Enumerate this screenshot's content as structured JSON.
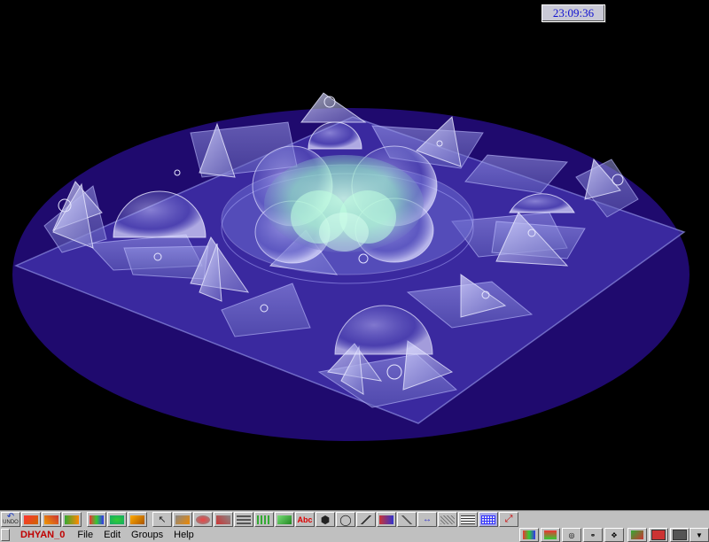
{
  "clock": {
    "time": "23:09:36"
  },
  "toolbar": {
    "undo_label": "UNDO",
    "text_tool_label": "Abc",
    "icons": [
      "undo-icon",
      "red-curves-icon",
      "orange-curve-icon",
      "green-arrow-icon",
      "colorful-shapes-icon",
      "green-spiral-icon",
      "orange-tool-icon",
      "pointer-icon",
      "pencil-icon",
      "rotate-icon",
      "scale-icon",
      "layers-icon",
      "grid-pattern-icon",
      "green-cube-icon",
      "text-tool-icon",
      "octagon-icon",
      "circle-icon",
      "line-tool-icon",
      "wave-icon",
      "diagonal-line-icon",
      "arrows-icon",
      "mesh-icon",
      "table-icon",
      "grid-icon",
      "axes-icon"
    ]
  },
  "menubar": {
    "project": "DHYAN_0",
    "menus": [
      "File",
      "Edit",
      "Groups",
      "Help"
    ]
  },
  "colors": {
    "disc": "#1f0a6e",
    "glow": "#a0ffd0",
    "accent": "#9090ff"
  }
}
